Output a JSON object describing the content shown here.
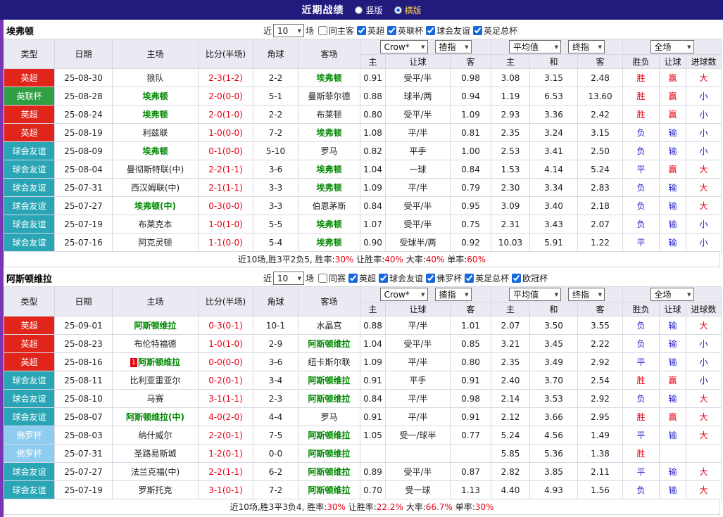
{
  "page": {
    "title": "近期战绩",
    "radios": [
      {
        "label": "竖版",
        "selected": false
      },
      {
        "label": "横版",
        "selected": true
      }
    ]
  },
  "icons": {
    "chevron_down": "▼"
  },
  "colors": {
    "topbar_bg": "#211b7d",
    "accent_strip": "#7a35b5",
    "score_red": "#e60012",
    "focus_team_green": "#008800",
    "type": {
      "英超": "#e2251b",
      "英联杯": "#2f9e44",
      "球会友谊": "#2aa5b5",
      "佛罗杯": "#8fcdf0"
    },
    "result": {
      "胜": "#e60012",
      "平": "#2020cc",
      "负": "#2020cc",
      "赢": "#e60012",
      "输": "#2020cc",
      "大": "#e60012",
      "小": "#2020cc"
    }
  },
  "table_common": {
    "filter": {
      "near": "近",
      "count": "10",
      "games": "场"
    },
    "selects": {
      "bookmaker": "Crow*",
      "index1": "揸指",
      "average": "平均值",
      "final": "终指",
      "scope": "全场"
    },
    "columns": [
      "类型",
      "日期",
      "主场",
      "比分(半场)",
      "角球",
      "客场"
    ],
    "sub": [
      "主",
      "让球",
      "客",
      "主",
      "和",
      "客",
      "胜负",
      "让球",
      "进球数"
    ]
  },
  "sections": [
    {
      "team": "埃弗顿",
      "filters": [
        {
          "label": "同主客",
          "checked": false
        },
        {
          "label": "英超",
          "checked": true
        },
        {
          "label": "英联杯",
          "checked": true
        },
        {
          "label": "球会友谊",
          "checked": true
        },
        {
          "label": "英足总杯",
          "checked": true
        }
      ],
      "rows": [
        {
          "type": "英超",
          "date": "25-08-30",
          "home": "狼队",
          "home_focus": false,
          "score": "2-3(1-2)",
          "corners": "2-2",
          "away": "埃弗顿",
          "away_focus": true,
          "odds": [
            "0.91",
            "受平/半",
            "0.98"
          ],
          "avg": [
            "3.08",
            "3.15",
            "2.48"
          ],
          "result": "胜",
          "let": "赢",
          "goal": "大"
        },
        {
          "type": "英联杯",
          "date": "25-08-28",
          "home": "埃弗顿",
          "home_focus": true,
          "score": "2-0(0-0)",
          "corners": "5-1",
          "away": "曼斯菲尔德",
          "away_focus": false,
          "odds": [
            "0.88",
            "球半/两",
            "0.94"
          ],
          "avg": [
            "1.19",
            "6.53",
            "13.60"
          ],
          "result": "胜",
          "let": "赢",
          "goal": "小"
        },
        {
          "type": "英超",
          "date": "25-08-24",
          "home": "埃弗顿",
          "home_focus": true,
          "score": "2-0(1-0)",
          "corners": "2-2",
          "away": "布莱顿",
          "away_focus": false,
          "odds": [
            "0.80",
            "受平/半",
            "1.09"
          ],
          "avg": [
            "2.93",
            "3.36",
            "2.42"
          ],
          "result": "胜",
          "let": "赢",
          "goal": "小"
        },
        {
          "type": "英超",
          "date": "25-08-19",
          "home": "利兹联",
          "home_focus": false,
          "score": "1-0(0-0)",
          "corners": "7-2",
          "away": "埃弗顿",
          "away_focus": true,
          "odds": [
            "1.08",
            "平/半",
            "0.81"
          ],
          "avg": [
            "2.35",
            "3.24",
            "3.15"
          ],
          "result": "负",
          "let": "输",
          "goal": "小"
        },
        {
          "type": "球会友谊",
          "date": "25-08-09",
          "home": "埃弗顿",
          "home_focus": true,
          "score": "0-1(0-0)",
          "corners": "5-10",
          "away": "罗马",
          "away_focus": false,
          "odds": [
            "0.82",
            "平手",
            "1.00"
          ],
          "avg": [
            "2.53",
            "3.41",
            "2.50"
          ],
          "result": "负",
          "let": "输",
          "goal": "小"
        },
        {
          "type": "球会友谊",
          "date": "25-08-04",
          "home": "曼彻斯特联(中)",
          "home_focus": false,
          "score": "2-2(1-1)",
          "corners": "3-6",
          "away": "埃弗顿",
          "away_focus": true,
          "odds": [
            "1.04",
            "一球",
            "0.84"
          ],
          "avg": [
            "1.53",
            "4.14",
            "5.24"
          ],
          "result": "平",
          "let": "赢",
          "goal": "大"
        },
        {
          "type": "球会友谊",
          "date": "25-07-31",
          "home": "西汉姆联(中)",
          "home_focus": false,
          "score": "2-1(1-1)",
          "corners": "3-3",
          "away": "埃弗顿",
          "away_focus": true,
          "odds": [
            "1.09",
            "平/半",
            "0.79"
          ],
          "avg": [
            "2.30",
            "3.34",
            "2.83"
          ],
          "result": "负",
          "let": "输",
          "goal": "大"
        },
        {
          "type": "球会友谊",
          "date": "25-07-27",
          "home": "埃弗顿(中)",
          "home_focus": true,
          "score": "0-3(0-0)",
          "corners": "3-3",
          "away": "伯恩茅斯",
          "away_focus": false,
          "odds": [
            "0.84",
            "受平/半",
            "0.95"
          ],
          "avg": [
            "3.09",
            "3.40",
            "2.18"
          ],
          "result": "负",
          "let": "输",
          "goal": "大"
        },
        {
          "type": "球会友谊",
          "date": "25-07-19",
          "home": "布莱克本",
          "home_focus": false,
          "score": "1-0(1-0)",
          "corners": "5-5",
          "away": "埃弗顿",
          "away_focus": true,
          "odds": [
            "1.07",
            "受平/半",
            "0.75"
          ],
          "avg": [
            "2.31",
            "3.43",
            "2.07"
          ],
          "result": "负",
          "let": "输",
          "goal": "小"
        },
        {
          "type": "球会友谊",
          "date": "25-07-16",
          "home": "阿克灵顿",
          "home_focus": false,
          "score": "1-1(0-0)",
          "corners": "5-4",
          "away": "埃弗顿",
          "away_focus": true,
          "odds": [
            "0.90",
            "受球半/两",
            "0.92"
          ],
          "avg": [
            "10.03",
            "5.91",
            "1.22"
          ],
          "result": "平",
          "let": "输",
          "goal": "小"
        }
      ],
      "summary": [
        {
          "t": "近10场,胜3平2负5, 胜率:"
        },
        {
          "t": "30%",
          "red": true
        },
        {
          "t": " 让胜率:"
        },
        {
          "t": "40%",
          "red": true
        },
        {
          "t": " 大率:"
        },
        {
          "t": "40%",
          "red": true
        },
        {
          "t": " 单率:"
        },
        {
          "t": "60%",
          "red": true
        }
      ]
    },
    {
      "team": "阿斯顿维拉",
      "filters": [
        {
          "label": "同赛",
          "checked": false
        },
        {
          "label": "英超",
          "checked": true
        },
        {
          "label": "球会友谊",
          "checked": true
        },
        {
          "label": "佛罗杯",
          "checked": true
        },
        {
          "label": "英足总杯",
          "checked": true
        },
        {
          "label": "欧冠杯",
          "checked": true
        }
      ],
      "rows": [
        {
          "type": "英超",
          "date": "25-09-01",
          "home": "阿斯顿维拉",
          "home_focus": true,
          "score": "0-3(0-1)",
          "corners": "10-1",
          "away": "水晶宫",
          "away_focus": false,
          "odds": [
            "0.88",
            "平/半",
            "1.01"
          ],
          "avg": [
            "2.07",
            "3.50",
            "3.55"
          ],
          "result": "负",
          "let": "输",
          "goal": "大"
        },
        {
          "type": "英超",
          "date": "25-08-23",
          "home": "布伦特福德",
          "home_focus": false,
          "score": "1-0(1-0)",
          "corners": "2-9",
          "away": "阿斯顿维拉",
          "away_focus": true,
          "odds": [
            "1.04",
            "受平/半",
            "0.85"
          ],
          "avg": [
            "3.21",
            "3.45",
            "2.22"
          ],
          "result": "负",
          "let": "输",
          "goal": "小"
        },
        {
          "type": "英超",
          "date": "25-08-16",
          "home": "阿斯顿维拉",
          "home_focus": true,
          "red_card": "1",
          "score": "0-0(0-0)",
          "corners": "3-6",
          "away": "纽卡斯尔联",
          "away_focus": false,
          "odds": [
            "1.09",
            "平/半",
            "0.80"
          ],
          "avg": [
            "2.35",
            "3.49",
            "2.92"
          ],
          "result": "平",
          "let": "输",
          "goal": "小"
        },
        {
          "type": "球会友谊",
          "date": "25-08-11",
          "home": "比利亚雷亚尔",
          "home_focus": false,
          "score": "0-2(0-1)",
          "corners": "3-4",
          "away": "阿斯顿维拉",
          "away_focus": true,
          "odds": [
            "0.91",
            "平手",
            "0.91"
          ],
          "avg": [
            "2.40",
            "3.70",
            "2.54"
          ],
          "result": "胜",
          "let": "赢",
          "goal": "小"
        },
        {
          "type": "球会友谊",
          "date": "25-08-10",
          "home": "马赛",
          "home_focus": false,
          "score": "3-1(1-1)",
          "corners": "2-3",
          "away": "阿斯顿维拉",
          "away_focus": true,
          "odds": [
            "0.84",
            "平/半",
            "0.98"
          ],
          "avg": [
            "2.14",
            "3.53",
            "2.92"
          ],
          "result": "负",
          "let": "输",
          "goal": "大"
        },
        {
          "type": "球会友谊",
          "date": "25-08-07",
          "home": "阿斯顿维拉(中)",
          "home_focus": true,
          "score": "4-0(2-0)",
          "corners": "4-4",
          "away": "罗马",
          "away_focus": false,
          "odds": [
            "0.91",
            "平/半",
            "0.91"
          ],
          "avg": [
            "2.12",
            "3.66",
            "2.95"
          ],
          "result": "胜",
          "let": "赢",
          "goal": "大"
        },
        {
          "type": "佛罗杯",
          "date": "25-08-03",
          "home": "纳什威尔",
          "home_focus": false,
          "score": "2-2(0-1)",
          "corners": "7-5",
          "away": "阿斯顿维拉",
          "away_focus": true,
          "odds": [
            "1.05",
            "受一/球半",
            "0.77"
          ],
          "avg": [
            "5.24",
            "4.56",
            "1.49"
          ],
          "result": "平",
          "let": "输",
          "goal": "大"
        },
        {
          "type": "佛罗杯",
          "date": "25-07-31",
          "home": "圣路易斯城",
          "home_focus": false,
          "score": "1-2(0-1)",
          "corners": "0-0",
          "away": "阿斯顿维拉",
          "away_focus": true,
          "odds": [
            "",
            "",
            ""
          ],
          "avg": [
            "5.85",
            "5.36",
            "1.38"
          ],
          "result": "胜",
          "let": "",
          "goal": ""
        },
        {
          "type": "球会友谊",
          "date": "25-07-27",
          "home": "法兰克福(中)",
          "home_focus": false,
          "score": "2-2(1-1)",
          "corners": "6-2",
          "away": "阿斯顿维拉",
          "away_focus": true,
          "odds": [
            "0.89",
            "受平/半",
            "0.87"
          ],
          "avg": [
            "2.82",
            "3.85",
            "2.11"
          ],
          "result": "平",
          "let": "输",
          "goal": "大"
        },
        {
          "type": "球会友谊",
          "date": "25-07-19",
          "home": "罗斯托克",
          "home_focus": false,
          "score": "3-1(0-1)",
          "corners": "7-2",
          "away": "阿斯顿维拉",
          "away_focus": true,
          "odds": [
            "0.70",
            "受一球",
            "1.13"
          ],
          "avg": [
            "4.40",
            "4.93",
            "1.56"
          ],
          "result": "负",
          "let": "输",
          "goal": "大"
        }
      ],
      "summary": [
        {
          "t": "近10场,胜3平3负4, 胜率:"
        },
        {
          "t": "30%",
          "red": true
        },
        {
          "t": " 让胜率:"
        },
        {
          "t": "22.2%",
          "red": true
        },
        {
          "t": " 大率:"
        },
        {
          "t": "66.7%",
          "red": true
        },
        {
          "t": " 单率:"
        },
        {
          "t": "30%",
          "red": true
        }
      ]
    }
  ]
}
